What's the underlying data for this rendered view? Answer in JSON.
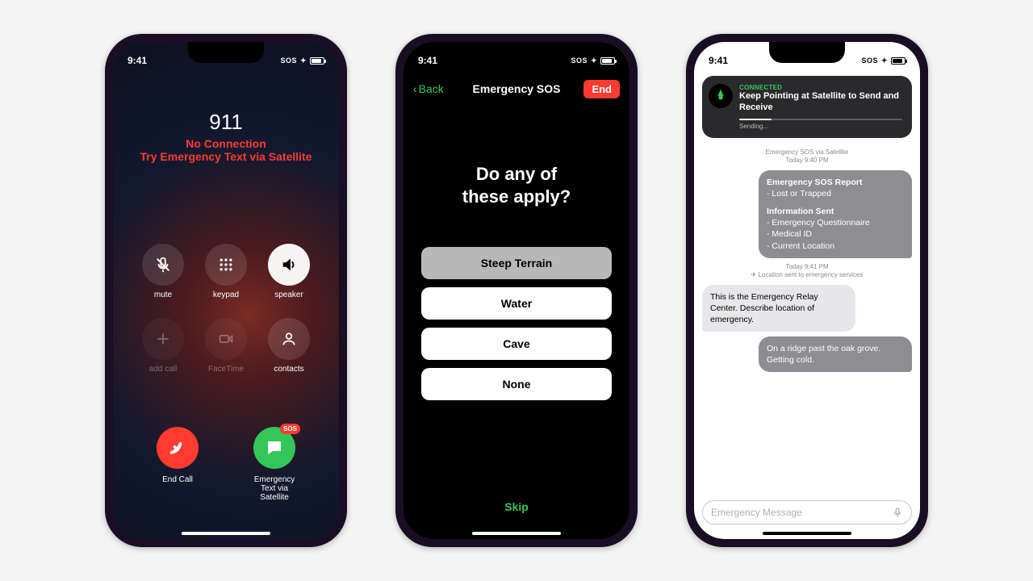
{
  "status": {
    "time": "9:41",
    "indicator_text": "SOS"
  },
  "phone1": {
    "title": "911",
    "line1": "No Connection",
    "line2": "Try Emergency Text via Satellite",
    "buttons": {
      "mute": "mute",
      "keypad": "keypad",
      "speaker": "speaker",
      "add_call": "add call",
      "facetime": "FaceTime",
      "contacts": "contacts"
    },
    "end_call": "End Call",
    "satellite": "Emergency\nText via\nSatellite",
    "sat_badge": "SOS"
  },
  "phone2": {
    "back": "Back",
    "title": "Emergency SOS",
    "end": "End",
    "question": "Do any of\nthese apply?",
    "options": [
      "Steep Terrain",
      "Water",
      "Cave",
      "None"
    ],
    "selected_index": 0,
    "skip": "Skip"
  },
  "phone3": {
    "banner": {
      "status": "CONNECTED",
      "title": "Keep Pointing at Satellite to Send and Receive",
      "sending": "Sending..."
    },
    "stamp1_line1": "Emergency SOS via Satellite",
    "stamp1_line2": "Today 9:40 PM",
    "report": {
      "title": "Emergency SOS Report",
      "item": "- Lost or Trapped",
      "info_title": "Information Sent",
      "info_items": [
        "- Emergency Questionnaire",
        "- Medical ID",
        "- Current Location"
      ]
    },
    "stamp2_line1": "Today 9:41 PM",
    "stamp2_line2": "Location sent to emergency services",
    "incoming": "This is the Emergency Relay Center. Describe location of emergency.",
    "reply": "On a ridge past the oak grove. Getting cold.",
    "input_placeholder": "Emergency Message"
  }
}
